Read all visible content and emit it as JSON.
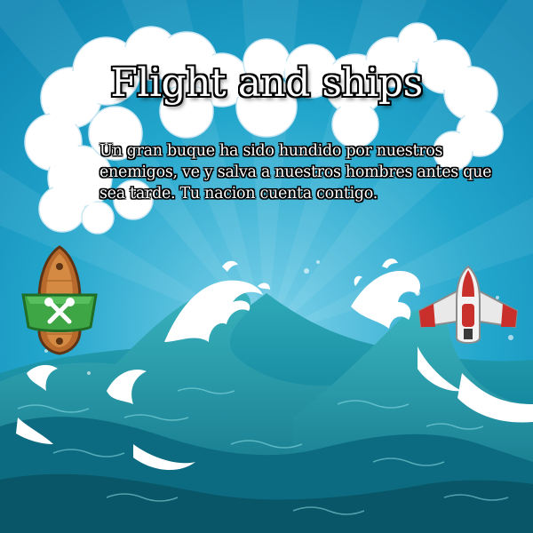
{
  "title": "Flight and ships",
  "description": "Un gran buque ha sido hundido por nuestros enemigos, ve y salva a nuestros hombres antes que sea tarde. Tu nacion cuenta contigo.",
  "colors": {
    "sky": "#1a9fc8",
    "sea_deep": "#0b6f86",
    "sea_light": "#2aa7b4",
    "foam": "#ffffff",
    "ship_hull": "#b86a2c",
    "ship_sail": "#3fa645",
    "plane_body": "#d9d9d9",
    "plane_accent": "#c9302c"
  },
  "icons": {
    "ship": "pirate-ship-icon",
    "plane": "fighter-plane-icon",
    "sun": "sun-icon"
  }
}
